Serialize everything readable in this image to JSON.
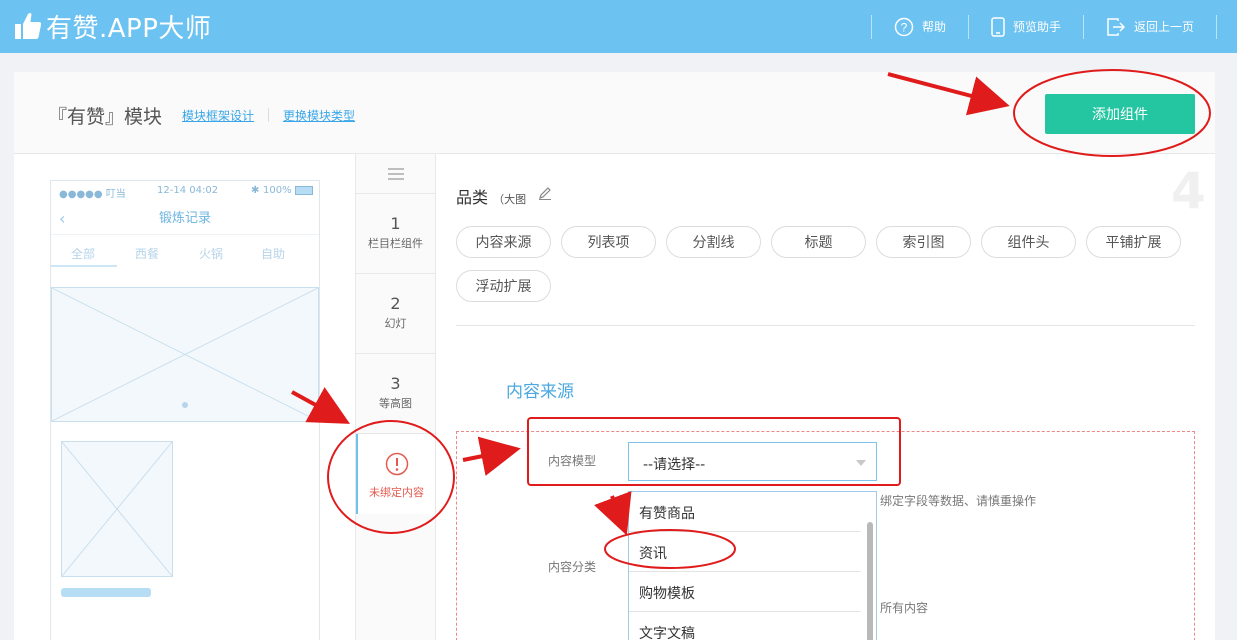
{
  "app": {
    "brand": "有赞.APP大师",
    "nav": [
      {
        "label": "帮助",
        "icon": "help-icon"
      },
      {
        "label": "预览助手",
        "icon": "phone-icon"
      },
      {
        "label": "返回上一页",
        "icon": "exit-icon"
      }
    ]
  },
  "header": {
    "title": "『有赞』模块",
    "links": [
      "模块框架设计",
      "更换模块类型"
    ],
    "add_button": "添加组件"
  },
  "phone": {
    "status_carrier": "●●●●● 叮当",
    "status_time": "12-14 04:02",
    "status_battery": "100%",
    "nav_title": "锻炼记录",
    "tabs": [
      "全部",
      "西餐",
      "火锅",
      "自助"
    ]
  },
  "component_list": [
    {
      "num": "1",
      "label": "栏目栏组件"
    },
    {
      "num": "2",
      "label": "幻灯"
    },
    {
      "num": "3",
      "label": "等高图"
    }
  ],
  "unbound_item": {
    "label": "未绑定内容",
    "icon": "warning-icon"
  },
  "config": {
    "watermark_number": "4",
    "category_title": "品类",
    "category_sub": "（大图",
    "chips": [
      "内容来源",
      "列表项",
      "分割线",
      "标题",
      "索引图",
      "组件头",
      "平铺扩展",
      "浮动扩展"
    ],
    "section_title": "内容来源",
    "content_model_label": "内容模型",
    "content_model_value": "--请选择--",
    "content_category_label": "内容分类",
    "helper_1": "绑定字段等数据、请慎重操作",
    "helper_2": "所有内容",
    "dropdown_options": [
      "有赞商品",
      "资讯",
      "购物模板",
      "文字文稿"
    ]
  },
  "colors": {
    "topbar": "#6cc2f0",
    "accent_button": "#24c5a1",
    "link": "#3aa6e8",
    "annotation_red": "#e01b1b"
  }
}
